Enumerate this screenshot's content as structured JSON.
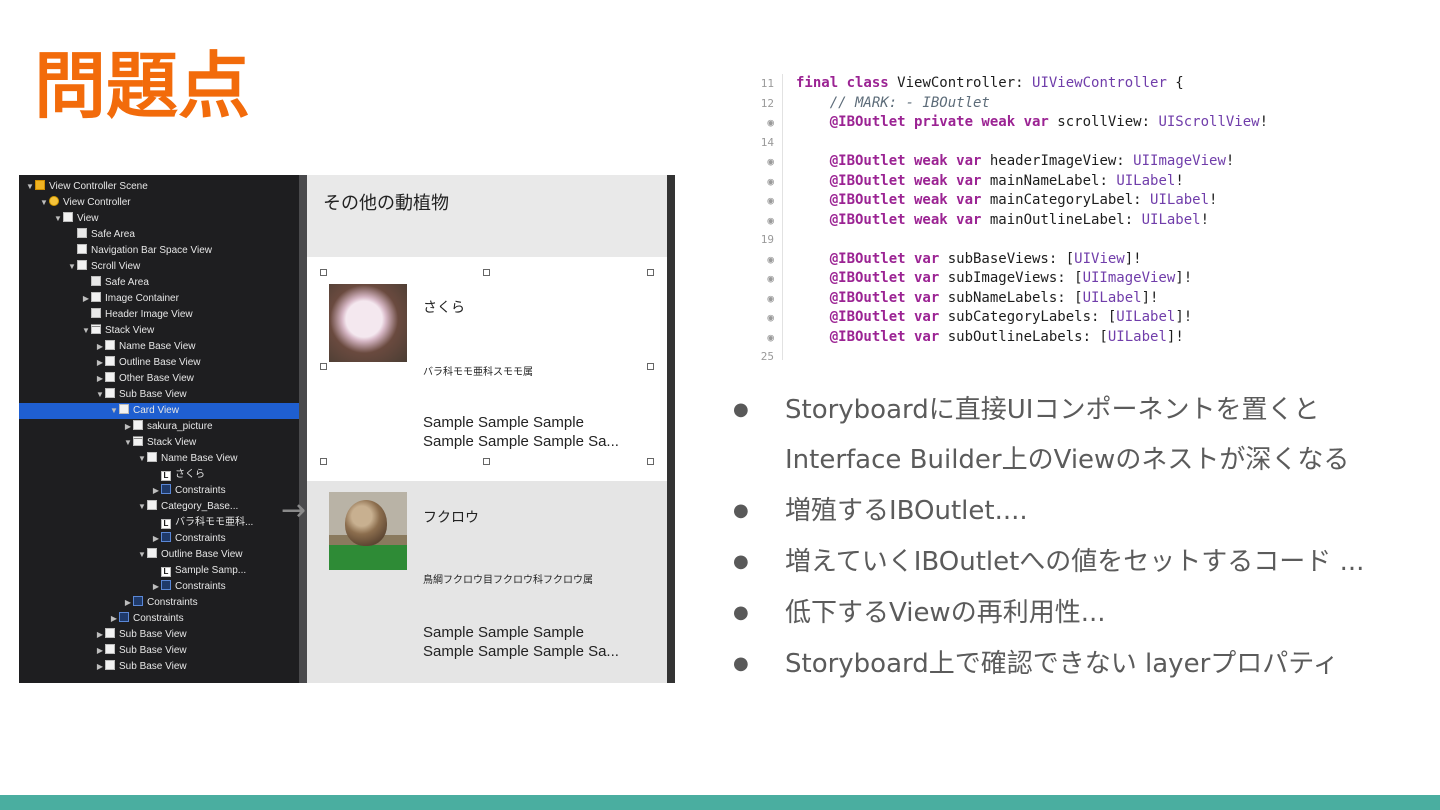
{
  "title": "問題点",
  "xcode": {
    "tree": [
      {
        "label": "View Controller Scene",
        "indent": 0,
        "icon": "scene",
        "tri": "▼"
      },
      {
        "label": "View Controller",
        "indent": 1,
        "icon": "vc",
        "tri": "▼"
      },
      {
        "label": "View",
        "indent": 2,
        "icon": "view",
        "tri": "▼"
      },
      {
        "label": "Safe Area",
        "indent": 3,
        "icon": "guide",
        "tri": ""
      },
      {
        "label": "Navigation Bar Space View",
        "indent": 3,
        "icon": "view",
        "tri": ""
      },
      {
        "label": "Scroll View",
        "indent": 3,
        "icon": "view",
        "tri": "▼"
      },
      {
        "label": "Safe Area",
        "indent": 4,
        "icon": "guide",
        "tri": ""
      },
      {
        "label": "Image Container",
        "indent": 4,
        "icon": "view",
        "tri": "▶"
      },
      {
        "label": "Header Image View",
        "indent": 4,
        "icon": "guide",
        "tri": ""
      },
      {
        "label": "Stack View",
        "indent": 4,
        "icon": "stack",
        "tri": "▼"
      },
      {
        "label": "Name Base View",
        "indent": 5,
        "icon": "view",
        "tri": "▶"
      },
      {
        "label": "Outline Base View",
        "indent": 5,
        "icon": "view",
        "tri": "▶"
      },
      {
        "label": "Other Base View",
        "indent": 5,
        "icon": "view",
        "tri": "▶"
      },
      {
        "label": "Sub Base View",
        "indent": 5,
        "icon": "view",
        "tri": "▼"
      },
      {
        "label": "Card View",
        "indent": 6,
        "icon": "view",
        "tri": "▼",
        "selected": true
      },
      {
        "label": "sakura_picture",
        "indent": 7,
        "icon": "view",
        "tri": "▶"
      },
      {
        "label": "Stack View",
        "indent": 7,
        "icon": "stack",
        "tri": "▼"
      },
      {
        "label": "Name Base View",
        "indent": 8,
        "icon": "view",
        "tri": "▼"
      },
      {
        "label": "さくら",
        "indent": 9,
        "icon": "lbl",
        "tri": ""
      },
      {
        "label": "Constraints",
        "indent": 9,
        "icon": "cons",
        "tri": "▶"
      },
      {
        "label": "Category_Base...",
        "indent": 8,
        "icon": "view",
        "tri": "▼"
      },
      {
        "label": "バラ科モモ亜科...",
        "indent": 9,
        "icon": "lbl",
        "tri": ""
      },
      {
        "label": "Constraints",
        "indent": 9,
        "icon": "cons",
        "tri": "▶"
      },
      {
        "label": "Outline Base View",
        "indent": 8,
        "icon": "view",
        "tri": "▼"
      },
      {
        "label": "Sample Samp...",
        "indent": 9,
        "icon": "lbl",
        "tri": ""
      },
      {
        "label": "Constraints",
        "indent": 9,
        "icon": "cons",
        "tri": "▶"
      },
      {
        "label": "Constraints",
        "indent": 7,
        "icon": "cons",
        "tri": "▶"
      },
      {
        "label": "Constraints",
        "indent": 6,
        "icon": "cons",
        "tri": "▶"
      },
      {
        "label": "Sub Base View",
        "indent": 5,
        "icon": "view",
        "tri": "▶"
      },
      {
        "label": "Sub Base View",
        "indent": 5,
        "icon": "view",
        "tri": "▶"
      },
      {
        "label": "Sub Base View",
        "indent": 5,
        "icon": "view",
        "tri": "▶"
      }
    ],
    "nav_title": "その他の動植物",
    "card1": {
      "name": "さくら",
      "category": "バラ科モモ亜科スモモ属",
      "outline_1": "Sample Sample Sample",
      "outline_2": "Sample Sample Sample Sa..."
    },
    "card2": {
      "name": "フクロウ",
      "category": "鳥綱フクロウ目フクロウ科フクロウ属",
      "outline_1": "Sample Sample Sample",
      "outline_2": "Sample Sample Sample Sa..."
    }
  },
  "code": {
    "gutter": [
      "11",
      "12",
      "◉",
      "14",
      "◉",
      "◉",
      "◉",
      "◉",
      "19",
      "◉",
      "◉",
      "◉",
      "◉",
      "◉",
      "25"
    ],
    "lines": [
      [
        [
          "kw",
          "final class "
        ],
        [
          "pl",
          "ViewController: "
        ],
        [
          "ty",
          "UIViewController"
        ],
        [
          "pl",
          " {"
        ]
      ],
      [
        [
          "cm",
          "    // MARK: - IBOutlet"
        ]
      ],
      [
        [
          "kw",
          "    @IBOutlet private weak var "
        ],
        [
          "pl",
          "scrollView: "
        ],
        [
          "ty",
          "UIScrollView"
        ],
        [
          "pl",
          "!"
        ]
      ],
      [],
      [
        [
          "kw",
          "    @IBOutlet weak var "
        ],
        [
          "pl",
          "headerImageView: "
        ],
        [
          "ty",
          "UIImageView"
        ],
        [
          "pl",
          "!"
        ]
      ],
      [
        [
          "kw",
          "    @IBOutlet weak var "
        ],
        [
          "pl",
          "mainNameLabel: "
        ],
        [
          "ty",
          "UILabel"
        ],
        [
          "pl",
          "!"
        ]
      ],
      [
        [
          "kw",
          "    @IBOutlet weak var "
        ],
        [
          "pl",
          "mainCategoryLabel: "
        ],
        [
          "ty",
          "UILabel"
        ],
        [
          "pl",
          "!"
        ]
      ],
      [
        [
          "kw",
          "    @IBOutlet weak var "
        ],
        [
          "pl",
          "mainOutlineLabel: "
        ],
        [
          "ty",
          "UILabel"
        ],
        [
          "pl",
          "!"
        ]
      ],
      [],
      [
        [
          "kw",
          "    @IBOutlet var "
        ],
        [
          "pl",
          "subBaseViews: ["
        ],
        [
          "ty",
          "UIView"
        ],
        [
          "pl",
          "]!"
        ]
      ],
      [
        [
          "kw",
          "    @IBOutlet var "
        ],
        [
          "pl",
          "subImageViews: ["
        ],
        [
          "ty",
          "UIImageView"
        ],
        [
          "pl",
          "]!"
        ]
      ],
      [
        [
          "kw",
          "    @IBOutlet var "
        ],
        [
          "pl",
          "subNameLabels: ["
        ],
        [
          "ty",
          "UILabel"
        ],
        [
          "pl",
          "]!"
        ]
      ],
      [
        [
          "kw",
          "    @IBOutlet var "
        ],
        [
          "pl",
          "subCategoryLabels: ["
        ],
        [
          "ty",
          "UILabel"
        ],
        [
          "pl",
          "]!"
        ]
      ],
      [
        [
          "kw",
          "    @IBOutlet var "
        ],
        [
          "pl",
          "subOutlineLabels: ["
        ],
        [
          "ty",
          "UILabel"
        ],
        [
          "pl",
          "]!"
        ]
      ],
      []
    ]
  },
  "bullets": [
    "Storyboardに直接UIコンポーネントを置くと",
    "Interface Builder上のViewのネストが深くなる",
    "増殖するIBOutlet....",
    "増えていくIBOutletへの値をセットするコード ...",
    "低下するViewの再利用性...",
    "Storyboard上で確認できない layerプロパティ"
  ],
  "bullet_marks": [
    true,
    false,
    true,
    true,
    true,
    true
  ],
  "colors": {
    "title": "#f26b0b",
    "footer": "#4aaea0",
    "selection": "#1f5fd1"
  }
}
